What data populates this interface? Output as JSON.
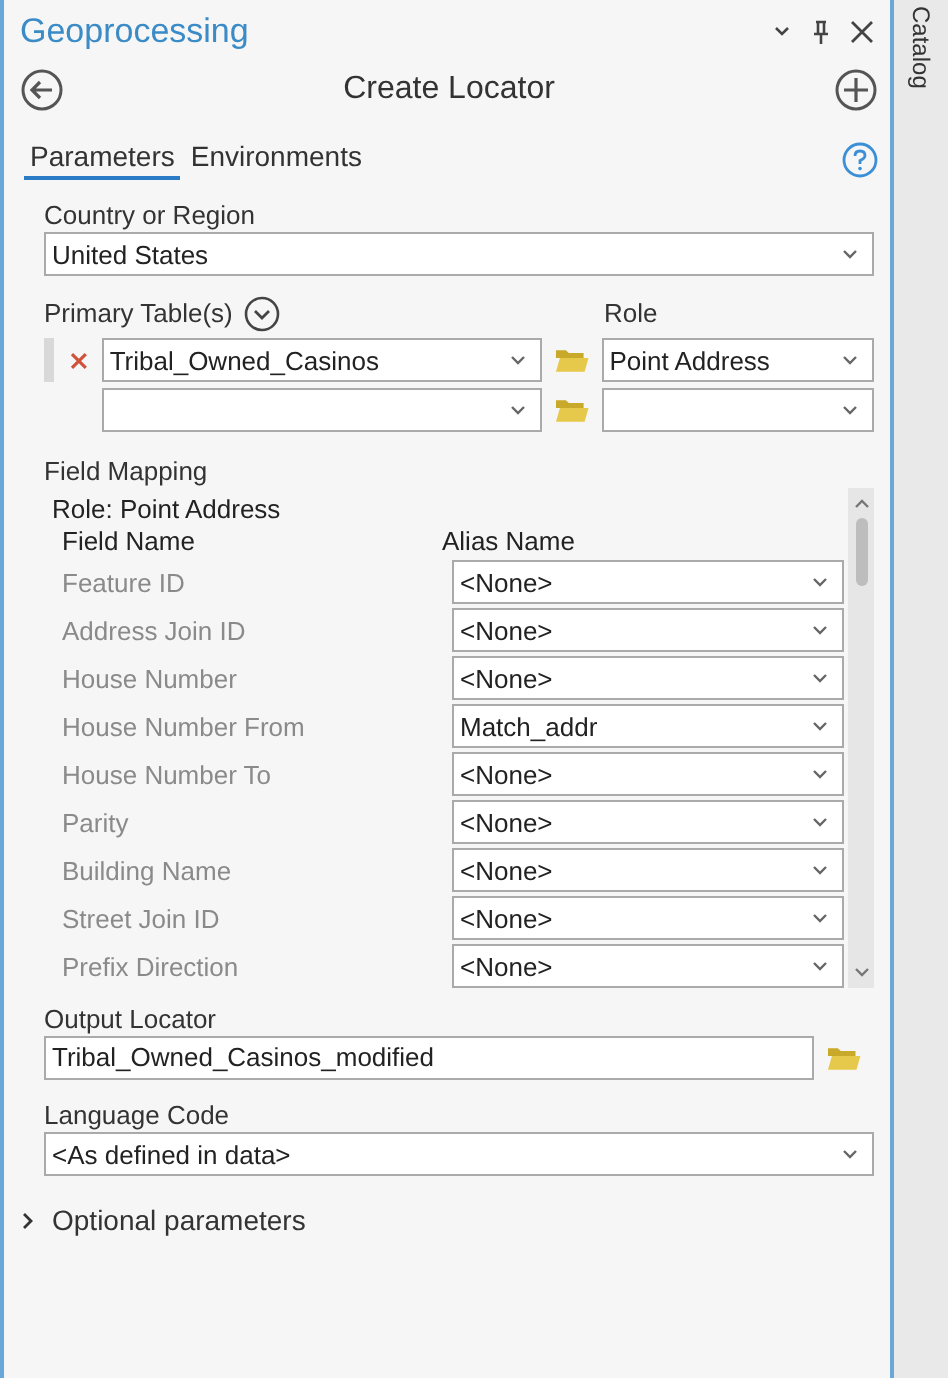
{
  "window": {
    "title": "Geoprocessing",
    "side_tab": "Catalog"
  },
  "tool": {
    "title": "Create Locator"
  },
  "tabs": [
    {
      "label": "Parameters",
      "selected": true
    },
    {
      "label": "Environments",
      "selected": false
    }
  ],
  "country": {
    "label": "Country or Region",
    "value": "United States"
  },
  "primary_tables": {
    "label": "Primary Table(s)",
    "role_label": "Role",
    "rows": [
      {
        "table": "Tribal_Owned_Casinos",
        "role": "Point Address",
        "removable": true
      },
      {
        "removable": false
      }
    ]
  },
  "field_mapping": {
    "label": "Field Mapping",
    "role": "Role: Point Address",
    "columns": [
      "Field Name",
      "Alias Name"
    ],
    "rows": [
      {
        "field": "Feature ID",
        "alias": "<None>"
      },
      {
        "field": "Address Join ID",
        "alias": "<None>"
      },
      {
        "field": "House Number",
        "alias": "<None>"
      },
      {
        "field": "House Number From",
        "alias": "Match_addr"
      },
      {
        "field": "House Number To",
        "alias": "<None>"
      },
      {
        "field": "Parity",
        "alias": "<None>"
      },
      {
        "field": "Building Name",
        "alias": "<None>"
      },
      {
        "field": "Street Join ID",
        "alias": "<None>"
      },
      {
        "field": "Prefix Direction",
        "alias": "<None>"
      }
    ]
  },
  "output_locator": {
    "label": "Output Locator",
    "value": "Tribal_Owned_Casinos_modified"
  },
  "language": {
    "label": "Language Code",
    "value": "<As defined in data>"
  },
  "optional": {
    "label": "Optional parameters",
    "expanded": false
  }
}
